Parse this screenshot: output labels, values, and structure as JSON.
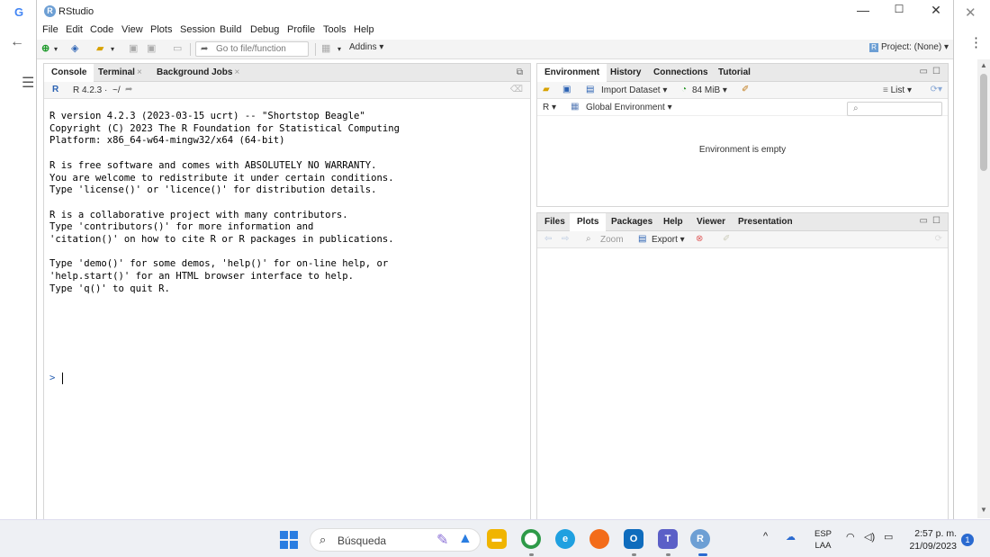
{
  "window": {
    "title": "RStudio",
    "logo": "R",
    "minimize": "—",
    "maximize": "☐",
    "close": "✕"
  },
  "menu": [
    "File",
    "Edit",
    "Code",
    "View",
    "Plots",
    "Session",
    "Build",
    "Debug",
    "Profile",
    "Tools",
    "Help"
  ],
  "toolbar": {
    "goto_placeholder": "Go to file/function",
    "addins": "Addins",
    "project": "Project: (None)"
  },
  "console": {
    "tabs": [
      {
        "label": "Console",
        "closable": false
      },
      {
        "label": "Terminal",
        "closable": true
      },
      {
        "label": "Background Jobs",
        "closable": true
      }
    ],
    "version": "R 4.2.3",
    "path": "~/",
    "lines": [
      "R version 4.2.3 (2023-03-15 ucrt) -- \"Shortstop Beagle\"",
      "Copyright (C) 2023 The R Foundation for Statistical Computing",
      "Platform: x86_64-w64-mingw32/x64 (64-bit)",
      "",
      "R is free software and comes with ABSOLUTELY NO WARRANTY.",
      "You are welcome to redistribute it under certain conditions.",
      "Type 'license()' or 'licence()' for distribution details.",
      "",
      "R is a collaborative project with many contributors.",
      "Type 'contributors()' for more information and",
      "'citation()' on how to cite R or R packages in publications.",
      "",
      "Type 'demo()' for some demos, 'help()' for on-line help, or",
      "'help.start()' for an HTML browser interface to help.",
      "Type 'q()' to quit R."
    ],
    "prompt": ">"
  },
  "environment": {
    "tabs": [
      "Environment",
      "History",
      "Connections",
      "Tutorial"
    ],
    "import_dataset": "Import Dataset",
    "memory": "84 MiB",
    "list_label": "List",
    "language": "R",
    "scope": "Global Environment",
    "empty_message": "Environment is empty"
  },
  "files": {
    "tabs": [
      "Files",
      "Plots",
      "Packages",
      "Help",
      "Viewer",
      "Presentation"
    ],
    "zoom": "Zoom",
    "export": "Export"
  },
  "taskbar": {
    "search_label": "Búsqueda",
    "lang_top": "ESP",
    "lang_bottom": "LAA",
    "time": "2:57 p. m.",
    "date": "21/09/2023",
    "notifications": "1",
    "rstudio_badge": "R"
  },
  "browser": {
    "google_letter": "G"
  },
  "colors": {
    "accent": "#2b62b3",
    "r_logo": "#6d9fd4",
    "taskbar_bg": "#eef0f4"
  }
}
